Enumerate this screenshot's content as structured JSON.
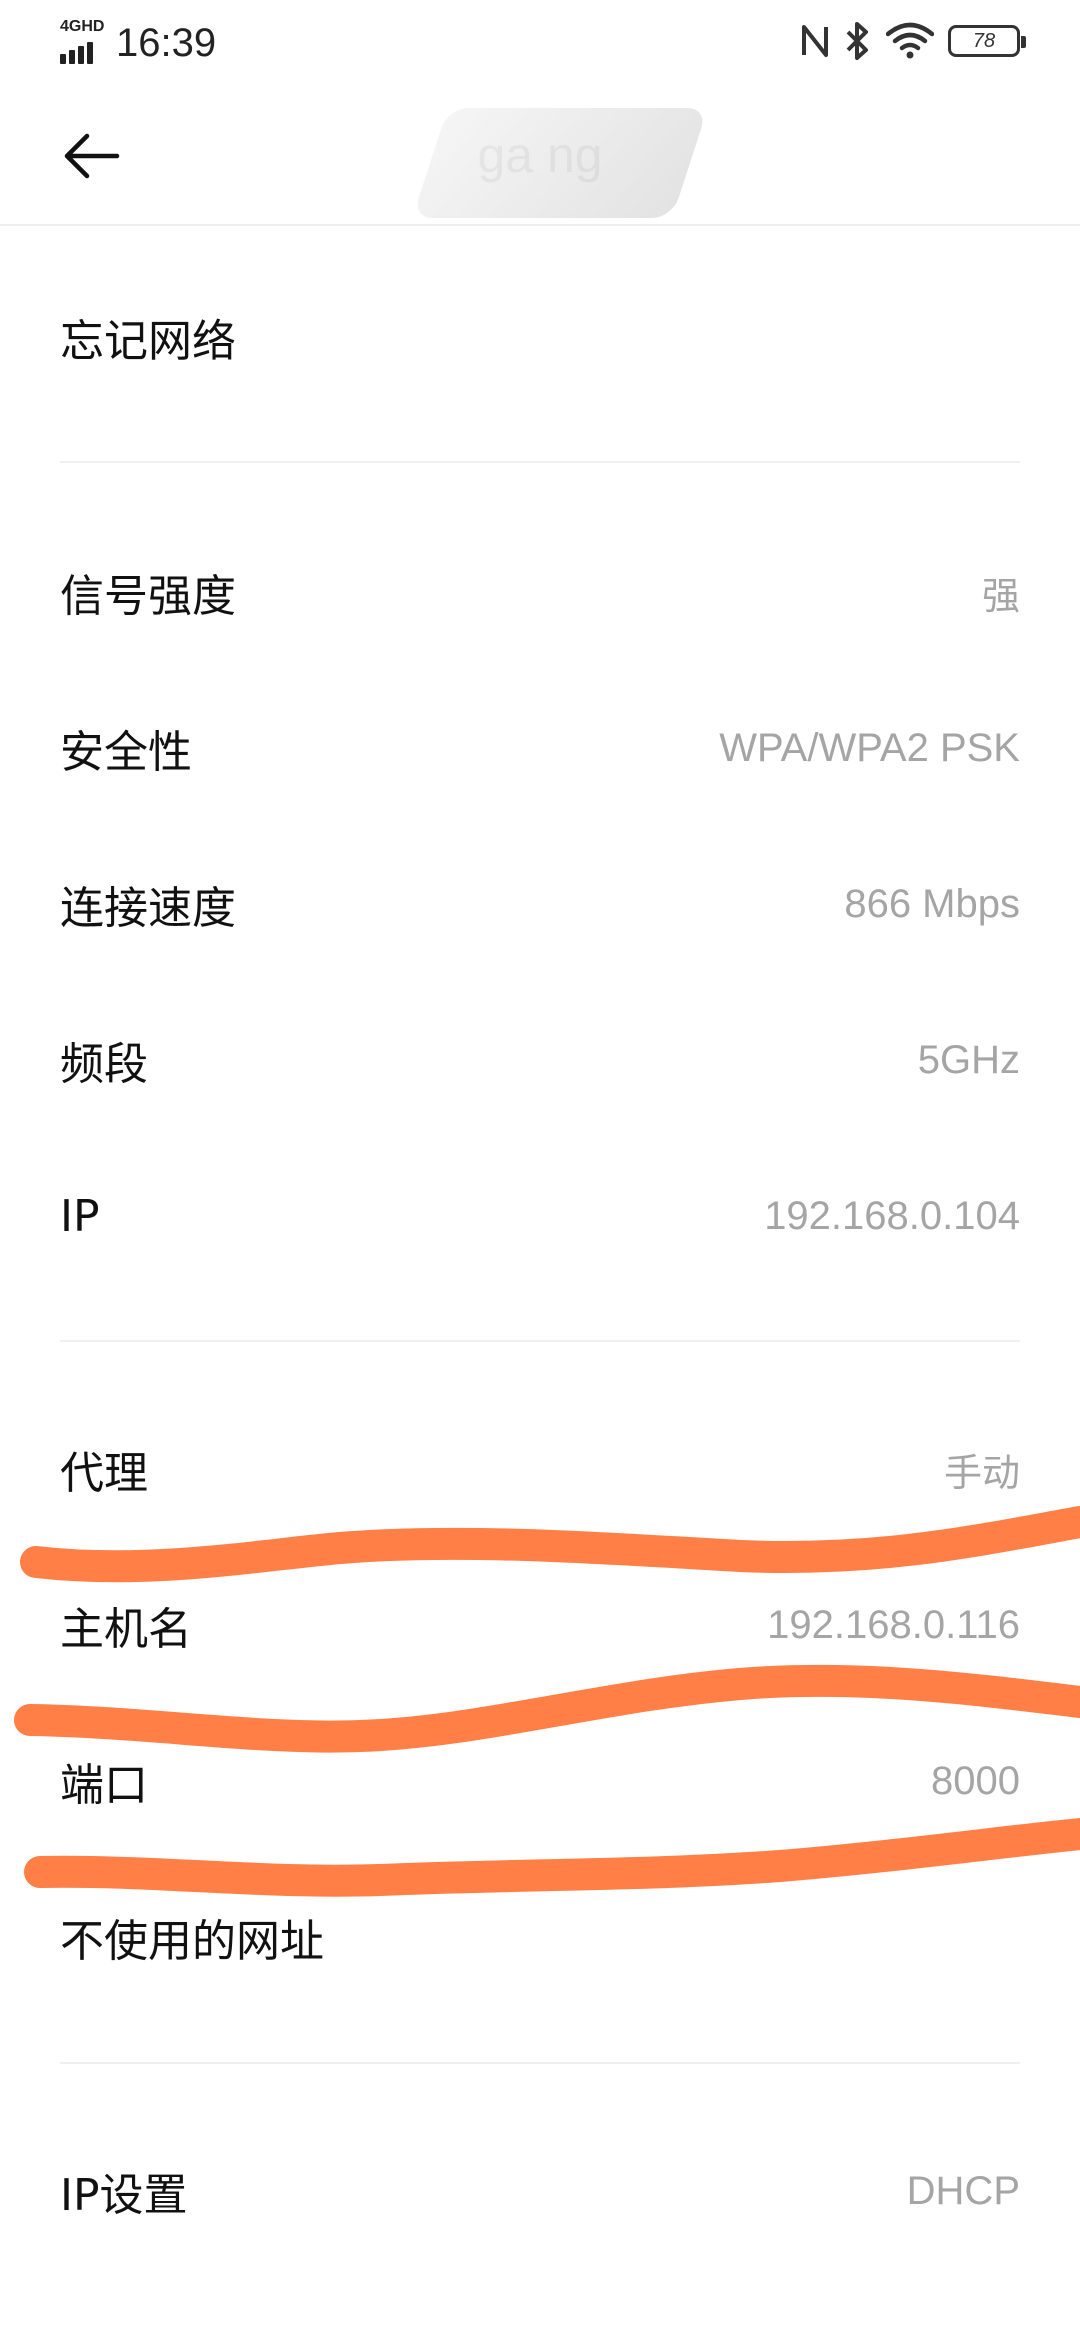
{
  "status_bar": {
    "network_label": "4GHD",
    "time": "16:39",
    "battery_level": "78",
    "icons": [
      "nfc-icon",
      "bluetooth-icon",
      "wifi-icon",
      "battery-icon"
    ]
  },
  "header": {
    "title": "ga        ng",
    "back_icon": "arrow-left-icon"
  },
  "actions": {
    "forget_network": "忘记网络"
  },
  "details": {
    "signal_label": "信号强度",
    "signal_value": "强",
    "security_label": "安全性",
    "security_value": "WPA/WPA2 PSK",
    "speed_label": "连接速度",
    "speed_value": "866 Mbps",
    "band_label": "频段",
    "band_value": "5GHz",
    "ip_label": "IP",
    "ip_value": "192.168.0.104"
  },
  "proxy": {
    "proxy_label": "代理",
    "proxy_value": "手动",
    "hostname_label": "主机名",
    "hostname_value": "192.168.0.116",
    "port_label": "端口",
    "port_value": "8000",
    "bypass_label": "不使用的网址"
  },
  "ip_settings": {
    "label": "IP设置",
    "value": "DHCP"
  },
  "colors": {
    "background": "#ffffff",
    "text_primary": "#111111",
    "text_secondary": "#a5a5a5",
    "divider": "#f0f0f0",
    "annotation_stroke": "#ff7f47"
  }
}
